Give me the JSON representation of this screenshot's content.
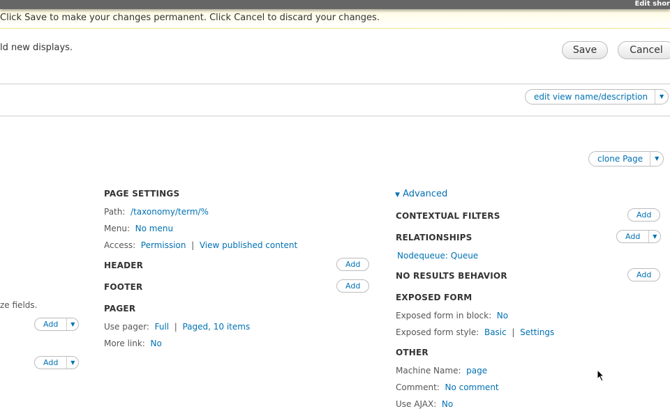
{
  "topbar": {
    "title": "Edit shor"
  },
  "message": "Click Save to make your changes permanent. Click Cancel to discard your changes.",
  "intro": "ld new displays.",
  "buttons": {
    "save": "Save",
    "cancel": "Cancel",
    "edit_view": "edit view name/description",
    "clone": "clone Page",
    "add": "Add",
    "dropdown": "▼"
  },
  "left": {
    "text": "ze fields."
  },
  "page_settings": {
    "title": "PAGE SETTINGS",
    "path": {
      "label": "Path:",
      "value": "/taxonomy/term/%"
    },
    "menu": {
      "label": "Menu:",
      "value": "No menu"
    },
    "access": {
      "label": "Access:",
      "value": "Permission",
      "sep": "|",
      "value2": "View published content"
    }
  },
  "header": "HEADER",
  "footer": "FOOTER",
  "pager": {
    "title": "PAGER",
    "use": {
      "label": "Use pager:",
      "value": "Full",
      "sep": "|",
      "value2": "Paged, 10 items"
    },
    "more": {
      "label": "More link:",
      "value": "No"
    }
  },
  "advanced": {
    "toggle": "Advanced",
    "contextual": "CONTEXTUAL FILTERS",
    "relationships": "RELATIONSHIPS",
    "relationship_item": "Nodequeue: Queue",
    "no_results": "NO RESULTS BEHAVIOR",
    "exposed": {
      "title": "EXPOSED FORM",
      "block": {
        "label": "Exposed form in block:",
        "value": "No"
      },
      "style": {
        "label": "Exposed form style:",
        "value": "Basic",
        "sep": "|",
        "value2": "Settings"
      }
    },
    "other": {
      "title": "OTHER",
      "machine": {
        "label": "Machine Name:",
        "value": "page"
      },
      "comment": {
        "label": "Comment:",
        "value": "No comment"
      },
      "ajax": {
        "label": "Use AJAX:",
        "value": "No"
      }
    }
  }
}
